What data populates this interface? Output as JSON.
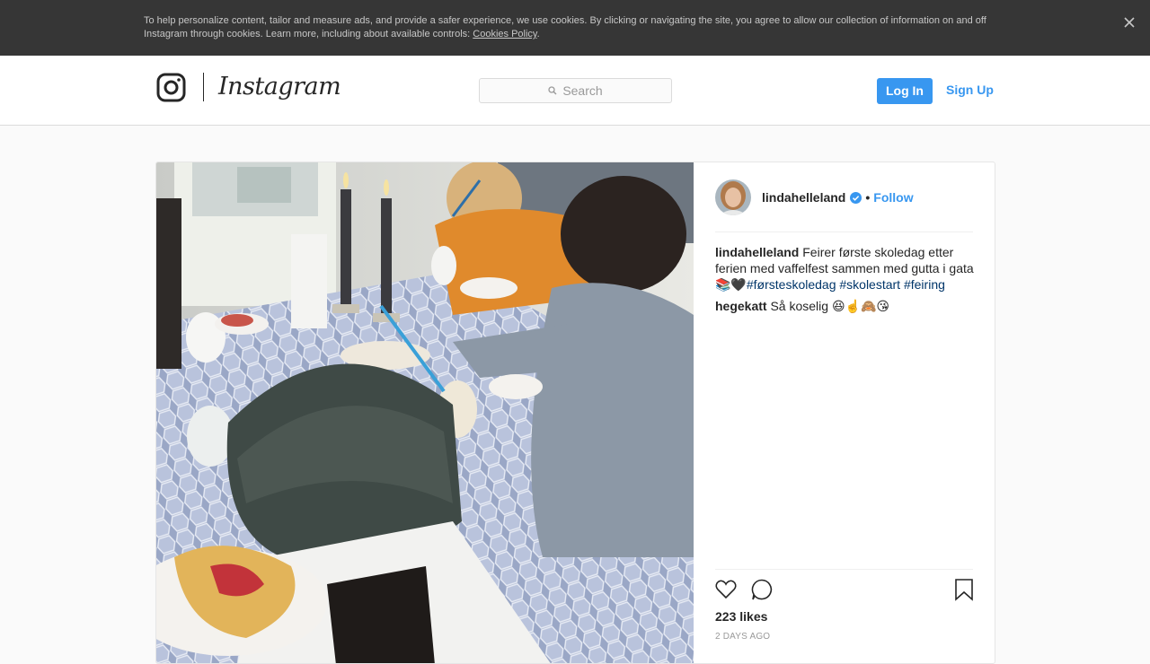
{
  "cookie_banner": {
    "text": "To help personalize content, tailor and measure ads, and provide a safer experience, we use cookies. By clicking or navigating the site, you agree to allow our collection of information on and off Instagram through cookies. Learn more, including about available controls: ",
    "link_label": "Cookies Policy",
    "suffix": ".",
    "close_icon": "close-icon"
  },
  "header": {
    "wordmark": "Instagram",
    "logo_icon": "instagram-glyph-icon",
    "search_placeholder": "Search",
    "login_label": "Log In",
    "signup_label": "Sign Up"
  },
  "post": {
    "author": {
      "username": "lindahelleland",
      "verified": true,
      "separator": "•",
      "follow_label": "Follow"
    },
    "caption": {
      "username": "lindahelleland",
      "text": "Feirer første skoledag etter ferien med vaffelfest sammen med gutta i gata📚🖤",
      "hashtags": [
        "#førsteskoledag",
        "#skolestart",
        "#feiring"
      ]
    },
    "comments": [
      {
        "username": "hegekatt",
        "text": "Så koselig 😆☝️🙈😘"
      }
    ],
    "likes": "223 likes",
    "timestamp": "2 DAYS AGO"
  },
  "colors": {
    "accent": "#3897f0",
    "banner_bg": "#363636",
    "hashtag": "#003569"
  }
}
